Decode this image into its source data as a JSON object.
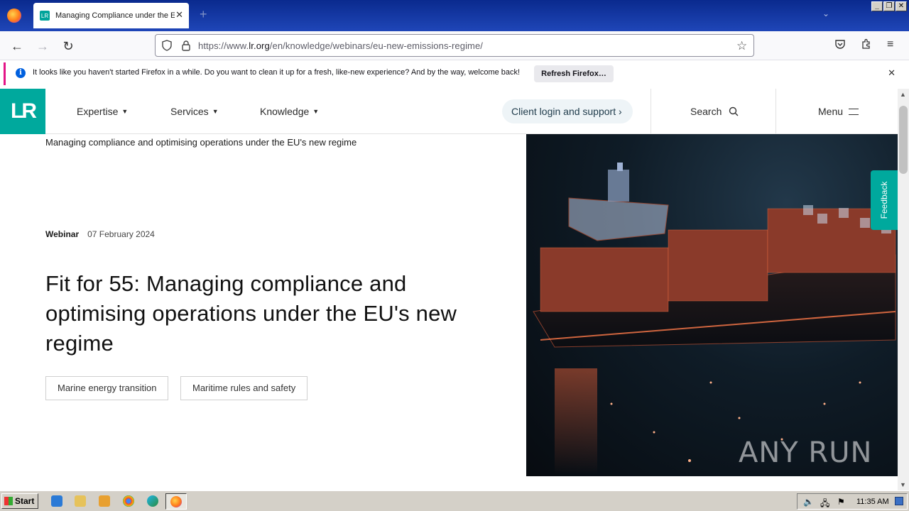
{
  "browser": {
    "tab_title": "Managing Compliance under the EU",
    "tab_favicon": "LR",
    "url_prefix": "https://www.",
    "url_host": "lr.org",
    "url_path": "/en/knowledge/webinars/eu-new-emissions-regime/",
    "notification_text": "It looks like you haven't started Firefox in a while. Do you want to clean it up for a fresh, like-new experience? And by the way, welcome back!",
    "notification_button": "Refresh Firefox…"
  },
  "site": {
    "logo_text": "LR",
    "nav": [
      {
        "label": "Expertise"
      },
      {
        "label": "Services"
      },
      {
        "label": "Knowledge"
      }
    ],
    "client_login": "Client login and support",
    "search_label": "Search",
    "menu_label": "Menu"
  },
  "article": {
    "breadcrumb": "Managing compliance and optimising operations under the EU's new regime",
    "type": "Webinar",
    "date": "07 February 2024",
    "title": "Fit for 55: Managing compliance and optimising operations under the EU's new regime",
    "tags": [
      "Marine energy transition",
      "Maritime rules and safety"
    ]
  },
  "feedback_label": "Feedback",
  "watermark": "ANY RUN",
  "taskbar": {
    "start_label": "Start",
    "clock": "11:35 AM"
  },
  "colors": {
    "brand_teal": "#00a99d",
    "titlebar_blue": "#0a2a8e"
  }
}
